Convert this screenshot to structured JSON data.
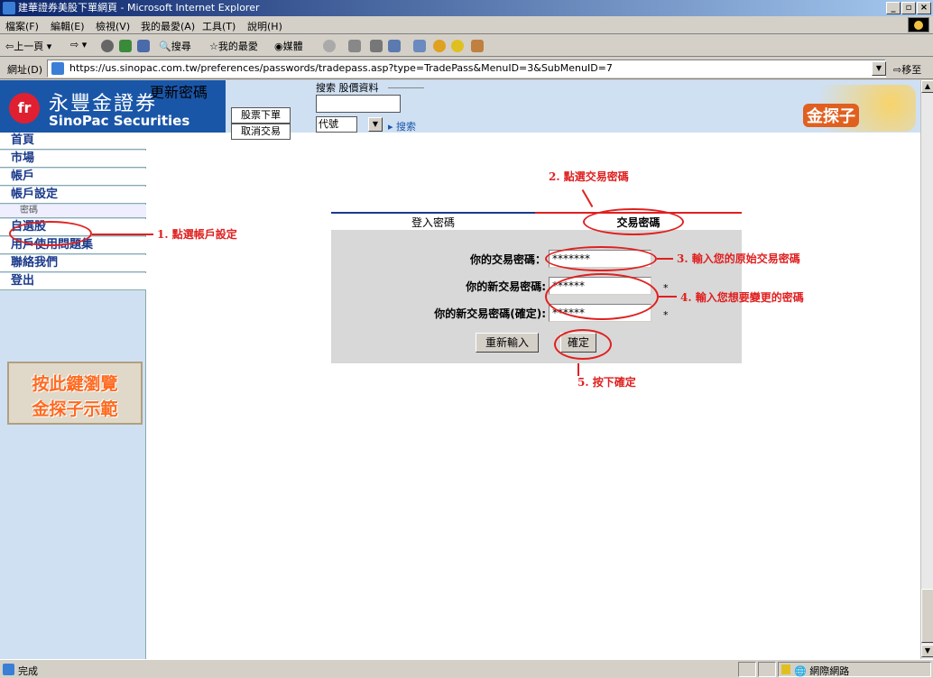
{
  "window": {
    "title": "建華證券美股下單網頁 - Microsoft Internet Explorer"
  },
  "menu": [
    "檔案(F)",
    "編輯(E)",
    "檢視(V)",
    "我的最愛(A)",
    "工具(T)",
    "說明(H)"
  ],
  "toolbar": {
    "back": "上一頁",
    "search": "搜尋",
    "favorites": "我的最愛",
    "media": "媒體"
  },
  "address": {
    "label": "網址(D)",
    "url": "https://us.sinopac.com.tw/preferences/passwords/tradepass.asp?type=TradePass&MenuID=3&SubMenuID=7",
    "go": "移至"
  },
  "header": {
    "logo_cn": "永豐金證券",
    "logo_en": "SinoPac Securities",
    "btn_order": "股票下單",
    "btn_cancel": "取消交易",
    "search_label": "搜索 股價資料",
    "code_select": "代號",
    "search_link": "搜索",
    "gold_logo": "金探子"
  },
  "sidebar": {
    "items": [
      "首頁",
      "市場",
      "帳戶",
      "帳戶設定",
      "密碼",
      "自選股",
      "用戶使用問題集",
      "聯絡我們",
      "登出"
    ],
    "promo_line1": "按此鍵瀏覽",
    "promo_line2": "金探子示範"
  },
  "content": {
    "title": "更新密碼",
    "tab_login": "登入密碼",
    "tab_trade": "交易密碼",
    "label_current": "你的交易密碼：",
    "label_new": "你的新交易密碼:",
    "label_confirm": "你的新交易密碼(確定):",
    "value_current": "*******",
    "value_new": "******",
    "value_confirm": "******",
    "required_mark": "*",
    "btn_reset": "重新輸入",
    "btn_submit": "確定"
  },
  "annotations": {
    "step1": "1. 點選帳戶設定",
    "step2": "2. 點選交易密碼",
    "step3": "3. 輸入您的原始交易密碼",
    "step4": "4. 輸入您想要變更的密碼",
    "step5": "5. 按下確定"
  },
  "status": {
    "text": "完成",
    "zone": "網際網路"
  },
  "colors": {
    "brand_blue": "#1a56a8",
    "annotation_red": "#e02020",
    "promo_orange": "#ff6a20"
  }
}
